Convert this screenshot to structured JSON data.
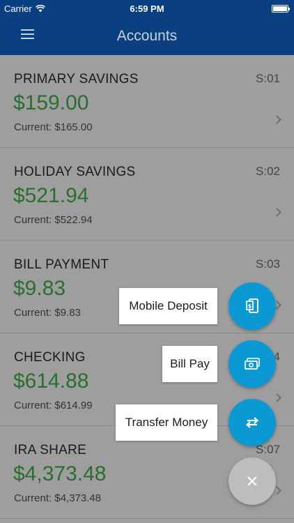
{
  "status_bar": {
    "carrier": "Carrier",
    "time": "6:59 PM"
  },
  "nav": {
    "title": "Accounts",
    "menu_icon": "hamburger-menu-icon"
  },
  "accounts": [
    {
      "name": "PRIMARY SAVINGS",
      "code": "S:01",
      "balance": "$159.00",
      "current": "Current: $165.00"
    },
    {
      "name": "HOLIDAY SAVINGS",
      "code": "S:02",
      "balance": "$521.94",
      "current": "Current: $522.94"
    },
    {
      "name": "BILL PAYMENT",
      "code": "S:03",
      "balance": "$9.83",
      "current": "Current: $9.83"
    },
    {
      "name": "CHECKING",
      "code": "S:04",
      "balance": "$614.88",
      "current": "Current: $614.99"
    },
    {
      "name": "IRA SHARE",
      "code": "S:07",
      "balance": "$4,373.48",
      "current": "Current: $4,373.48"
    }
  ],
  "fab_menu": {
    "mobile_deposit": {
      "label": "Mobile Deposit",
      "icon": "mobile-deposit-icon"
    },
    "bill_pay": {
      "label": "Bill Pay",
      "icon": "cash-icon"
    },
    "transfer_money": {
      "label": "Transfer Money",
      "icon": "transfer-arrows-icon"
    },
    "close_icon": "close-icon"
  },
  "colors": {
    "nav_background": "#0a3f82",
    "balance_green": "#2a6e2e",
    "fab_blue": "#0b99d4",
    "fab_close_gray": "#bdbdbd",
    "overlay_gray": "#9e9e9e"
  }
}
